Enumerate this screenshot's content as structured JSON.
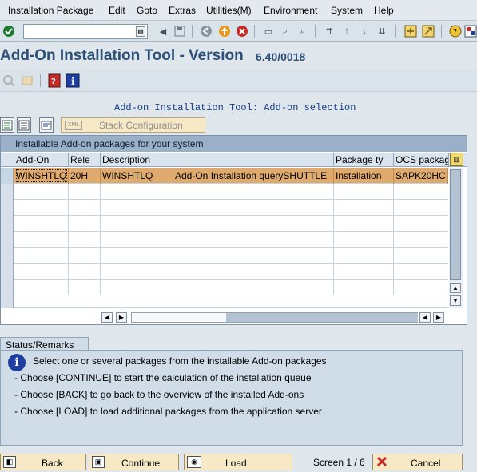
{
  "menu": [
    "Installation Package",
    "Edit",
    "Goto",
    "Extras",
    "Utilities(M)",
    "Environment",
    "System",
    "Help"
  ],
  "toolbar": {
    "okcode_value": "",
    "icons": [
      "enter-icon",
      "save-icon",
      "back-icon",
      "exit-icon",
      "cancel-icon",
      "print-icon",
      "find-icon",
      "find-next-icon",
      "first-page-icon",
      "previous-page-icon",
      "next-page-icon",
      "last-page-icon",
      "create-session-icon",
      "shortcut-icon",
      "help-icon",
      "customize-layout-icon"
    ]
  },
  "title": {
    "main": "Add-On Installation Tool - Version",
    "version": "6.40/0018"
  },
  "selection_title": "Add-on Installation Tool: Add-on selection",
  "stack_button": {
    "xml": "XML",
    "label": "Stack Configuration"
  },
  "table": {
    "title": "Installable Add-on packages for your system",
    "columns": [
      "Add-On",
      "Rele",
      "Description",
      "Package ty",
      "OCS packag"
    ],
    "rows": [
      {
        "addon": "WINSHTLQ",
        "release": "20H",
        "description": "WINSHTLQ",
        "description2": "Add-On Installation querySHUTTLE",
        "package_type": "Installation",
        "ocs_package": "SAPK20HC"
      }
    ]
  },
  "status": {
    "tab": "Status/Remarks",
    "info": "i",
    "lines": [
      "Select one or several packages from the installable Add-on packages",
      "- Choose [CONTINUE] to start the calculation of the installation queue",
      "- Choose [BACK] to go back to the overview of the installed Add-ons",
      "- Choose [LOAD] to load additional packages from the application server"
    ]
  },
  "footer": {
    "back": "Back",
    "continue": "Continue",
    "load": "Load",
    "screen": "Screen 1 / 6",
    "cancel": "Cancel"
  },
  "colors": {
    "title_blue": "#2c4f78",
    "selected_row": "#e0a96e",
    "button_bg": "#f7e9c5",
    "panel_bg": "#d0dce8"
  }
}
